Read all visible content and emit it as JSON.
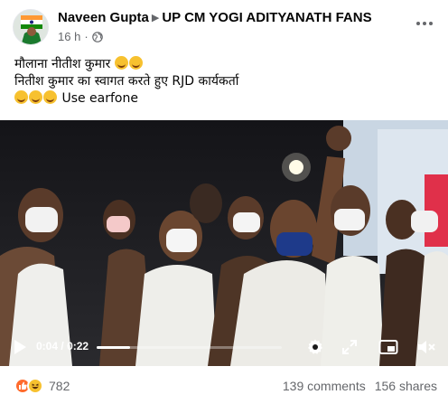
{
  "post": {
    "author": "Naveen Gupta",
    "group": "UP CM YOGI ADITYANATH FANS",
    "time": "16 h",
    "dot": "·",
    "caption": [
      "मौलाना नीतीश कुमार",
      "नितीश कुमार का स्वागत करते हुए RJD कार्यकर्ता",
      "Use earfone"
    ]
  },
  "video": {
    "elapsed": "0:04",
    "separator": "/",
    "duration": "0:22",
    "progress_fraction": 0.18
  },
  "footer": {
    "reaction_count": "782",
    "comments": "139 comments",
    "shares": "156 shares"
  },
  "icons": {
    "globe": "globe-icon",
    "more": "more-options-icon",
    "play": "play-icon",
    "settings": "gear-icon",
    "expand": "expand-icon",
    "pip": "picture-in-picture-icon",
    "mute": "mute-icon"
  },
  "colors": {
    "text": "#050505",
    "secondary": "#65676b",
    "like_reaction": "#ff6b2d",
    "haha_reaction": "#f7c12f"
  }
}
